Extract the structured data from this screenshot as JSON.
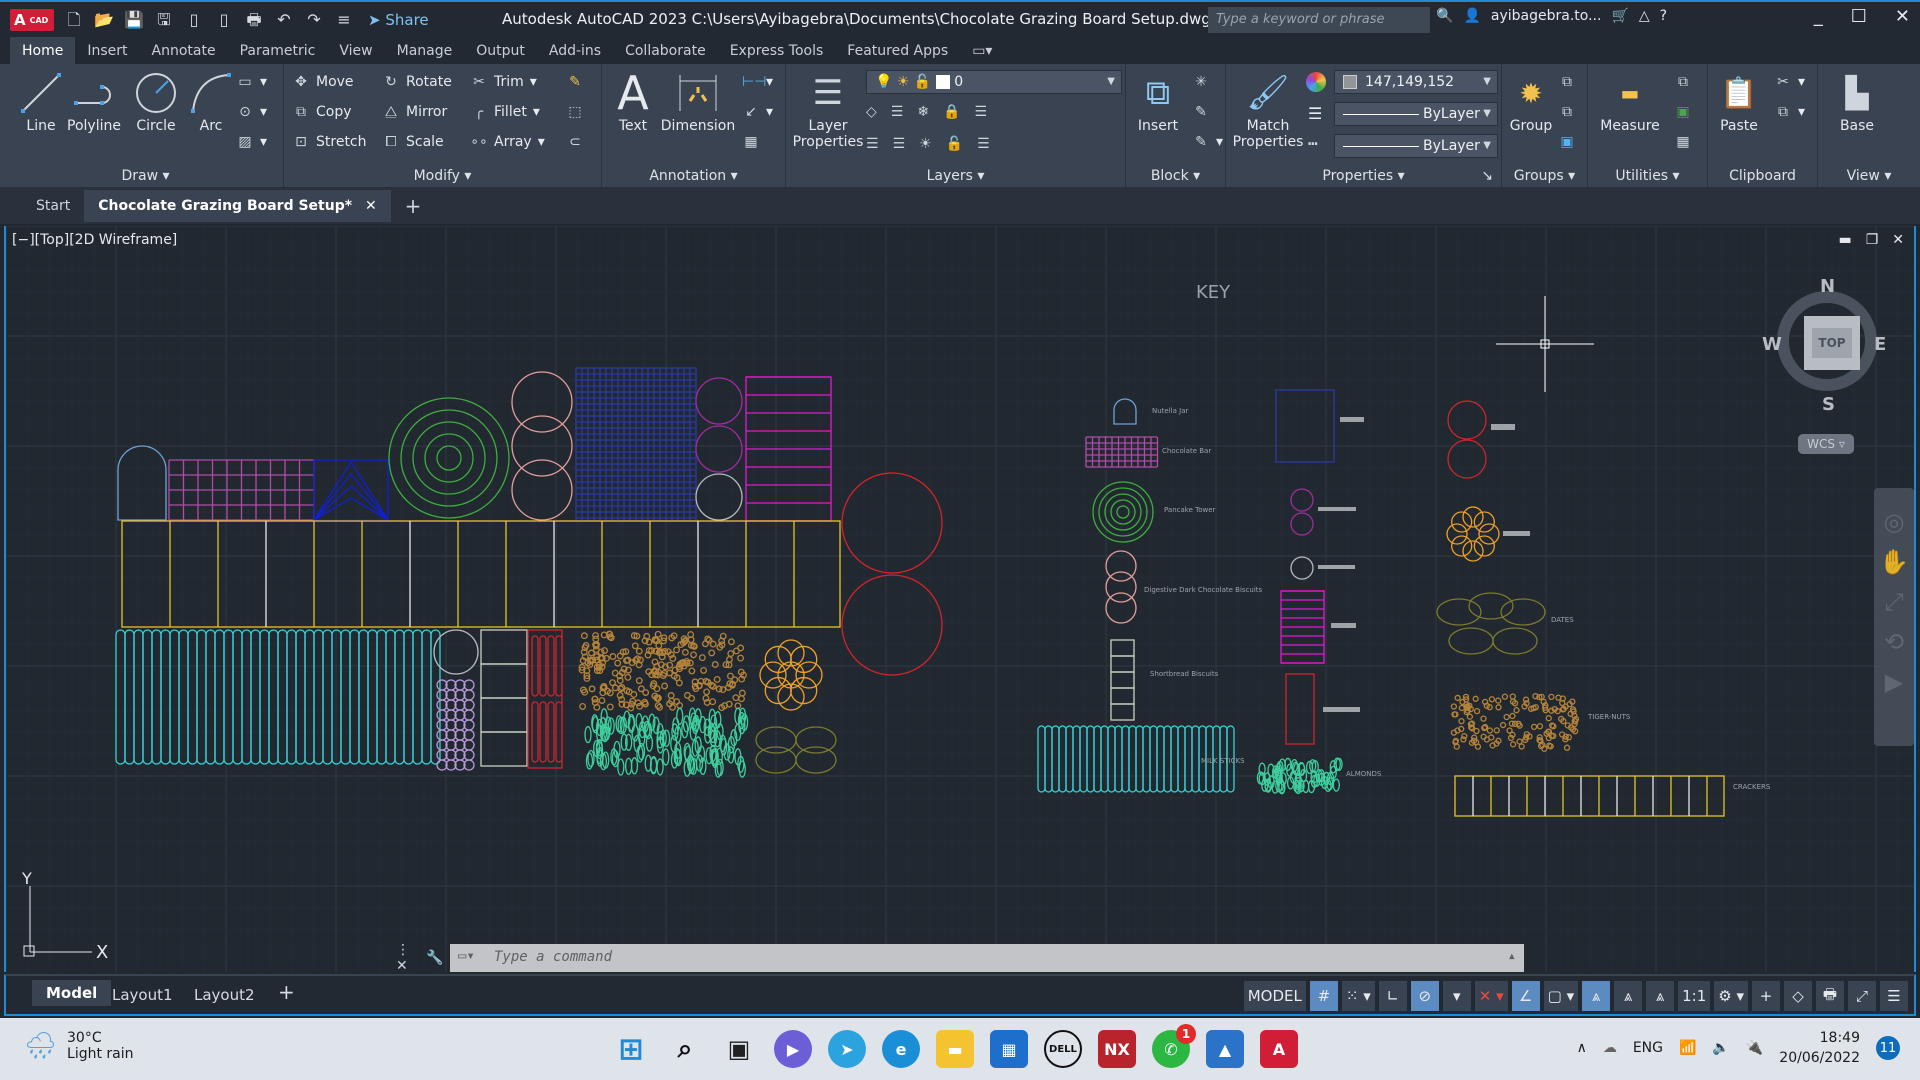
{
  "titlebar": {
    "logo_text": "A",
    "logo_sub": "CAD",
    "share_label": "Share",
    "title": "Autodesk AutoCAD 2023   C:\\Users\\Ayibagebra\\Documents\\Chocolate Grazing Board Setup.dwg",
    "search_placeholder": "Type a keyword or phrase",
    "user": "ayibagebra.to...",
    "quick_access_icons": [
      "new-icon",
      "open-icon",
      "save-icon",
      "save-as-icon",
      "open-from-web-icon",
      "save-to-web-icon",
      "plot-icon",
      "undo-icon",
      "redo-icon",
      "customize-icon"
    ]
  },
  "ribbon_tabs": [
    "Home",
    "Insert",
    "Annotate",
    "Parametric",
    "View",
    "Manage",
    "Output",
    "Add-ins",
    "Collaborate",
    "Express Tools",
    "Featured Apps"
  ],
  "ribbon": {
    "draw": {
      "title": "Draw",
      "line": "Line",
      "polyline": "Polyline",
      "circle": "Circle",
      "arc": "Arc"
    },
    "modify": {
      "title": "Modify",
      "move": "Move",
      "rotate": "Rotate",
      "trim": "Trim",
      "copy": "Copy",
      "mirror": "Mirror",
      "fillet": "Fillet",
      "stretch": "Stretch",
      "scale": "Scale",
      "array": "Array"
    },
    "annotation": {
      "title": "Annotation",
      "text": "Text",
      "dimension": "Dimension"
    },
    "layers": {
      "title": "Layers",
      "layer_properties_1": "Layer",
      "layer_properties_2": "Properties",
      "current_layer": "0"
    },
    "block": {
      "title": "Block",
      "insert": "Insert"
    },
    "properties": {
      "title": "Properties",
      "match_1": "Match",
      "match_2": "Properties",
      "color": "147,149,152",
      "linetype": "ByLayer",
      "lineweight": "ByLayer"
    },
    "groups": {
      "title": "Groups",
      "group": "Group"
    },
    "utilities": {
      "title": "Utilities",
      "measure": "Measure"
    },
    "clipboard": {
      "title": "Clipboard",
      "paste": "Paste"
    },
    "view": {
      "title": "View",
      "base": "Base"
    }
  },
  "doc_tabs": {
    "start": "Start",
    "active": "Chocolate Grazing Board Setup*"
  },
  "viewport": {
    "label": "[−][Top][2D Wireframe]",
    "key_title": "KEY",
    "viewcube": {
      "n": "N",
      "s": "S",
      "e": "E",
      "w": "W",
      "face": "TOP",
      "ucs": "WCS"
    },
    "ucs_x": "X",
    "ucs_y": "Y",
    "key_items": [
      "Nutella Jar",
      "Chocolate Bar",
      "Pancake Tower",
      "Digestive Dark Chocolate Biscuits",
      "Shortbread Biscuits",
      "MILK STICKS",
      "ALMONDS",
      "DATES",
      "TIGER-NUTS",
      "CRACKERS"
    ]
  },
  "colors": {
    "nutella": "#6fa2d6",
    "chocbar": "#b04ca8",
    "pancake": "#3fae3f",
    "digestive": "#e59e9a",
    "blue_grid": "#2b3aa4",
    "purple": "#a02c9e",
    "gray": "#b6b9bd",
    "magenta": "#e01ad0",
    "red": "#d0242c",
    "yellow": "#e6c329",
    "cyan": "#36d3d6",
    "lilac": "#b89ad9",
    "shortbread": "#c5d2c0",
    "tiger": "#b5843a",
    "almond": "#3fcf9e",
    "orange": "#f0a226",
    "dates": "#7c7a2c",
    "triangle": "#1020d8"
  },
  "command": {
    "placeholder": "Type a command"
  },
  "layout_tabs": [
    "Model",
    "Layout1",
    "Layout2"
  ],
  "status": {
    "model": "MODEL",
    "scale": "1:1"
  },
  "taskbar": {
    "temp": "30°C",
    "weather": "Light rain",
    "lang": "ENG",
    "time": "18:49",
    "date": "20/06/2022",
    "notif_count": "11",
    "whatsapp_badge": "1"
  }
}
